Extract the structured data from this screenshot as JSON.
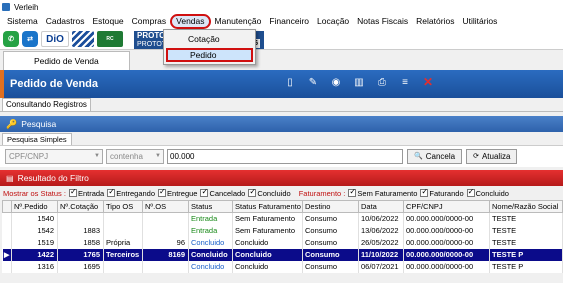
{
  "window": {
    "title": "Verleih"
  },
  "menu": [
    "Sistema",
    "Cadastros",
    "Estoque",
    "Compras",
    "Vendas",
    "Manutenção",
    "Financeiro",
    "Locação",
    "Notas Fiscais",
    "Relatórios",
    "Utilitários"
  ],
  "menu_highlight_index": 4,
  "dropdown": {
    "items": [
      "Cotação",
      "Pedido"
    ],
    "selected_index": 1
  },
  "toolbar": {
    "dio_label": "DiO",
    "rc_label": "RC",
    "proto_title": "PROTO",
    "proto_sub": "PROTOT",
    "proto_num": "01-36"
  },
  "tab": {
    "label": "Pedido de Venda"
  },
  "header": {
    "title": "Pedido de Venda"
  },
  "consult_tab": "Consultando Registros",
  "search_section": "Pesquisa",
  "search_subtab": "Pesquisa Simples",
  "search": {
    "field": "CPF/CNPJ",
    "operator": "contenha",
    "value": "00.000",
    "cancel_label": "Cancela",
    "refresh_label": "Atualiza"
  },
  "results_section": "Resultado do Filtro",
  "status_filter": {
    "label": "Mostrar os Status :",
    "options": [
      "Entrada",
      "Entregando",
      "Entregue",
      "Cancelado",
      "Concluido"
    ]
  },
  "billing_filter": {
    "label": "Faturamento :",
    "options": [
      "Sem Faturamento",
      "Faturando",
      "Concluido"
    ]
  },
  "table": {
    "columns": [
      "Nº.Pedido",
      "Nº.Cotação",
      "Tipo OS",
      "Nº.OS",
      "Status",
      "Status Faturamento",
      "Destino",
      "Data",
      "CPF/CNPJ",
      "Nome/Razão Social"
    ],
    "rows": [
      {
        "pedido": "1540",
        "cotacao": "",
        "tipo": "",
        "os": "",
        "status": "Entrada",
        "fat": "Sem Faturamento",
        "destino": "Consumo",
        "data": "10/06/2022",
        "cpf": "00.000.000/0000-00",
        "nome": "TESTE",
        "statusColor": "green"
      },
      {
        "pedido": "1542",
        "cotacao": "1883",
        "tipo": "",
        "os": "",
        "status": "Entrada",
        "fat": "Sem Faturamento",
        "destino": "Consumo",
        "data": "13/06/2022",
        "cpf": "00.000.000/0000-00",
        "nome": "TESTE",
        "statusColor": "green"
      },
      {
        "pedido": "1519",
        "cotacao": "1858",
        "tipo": "Própria",
        "os": "96",
        "status": "Concluido",
        "fat": "Concluido",
        "destino": "Consumo",
        "data": "26/05/2022",
        "cpf": "00.000.000/0000-00",
        "nome": "TESTE",
        "statusColor": "blue"
      },
      {
        "pedido": "1422",
        "cotacao": "1765",
        "tipo": "Terceiros",
        "os": "8169",
        "status": "Concluido",
        "fat": "Concluido",
        "destino": "Consumo",
        "data": "11/10/2022",
        "cpf": "00.000.000/0000-00",
        "nome": "TESTE P",
        "statusColor": "blue",
        "selected": true
      },
      {
        "pedido": "1316",
        "cotacao": "1695",
        "tipo": "",
        "os": "",
        "status": "Concluido",
        "fat": "Concluido",
        "destino": "Consumo",
        "data": "06/07/2021",
        "cpf": "00.000.000/0000-00",
        "nome": "TESTE P",
        "statusColor": "blue"
      }
    ]
  }
}
